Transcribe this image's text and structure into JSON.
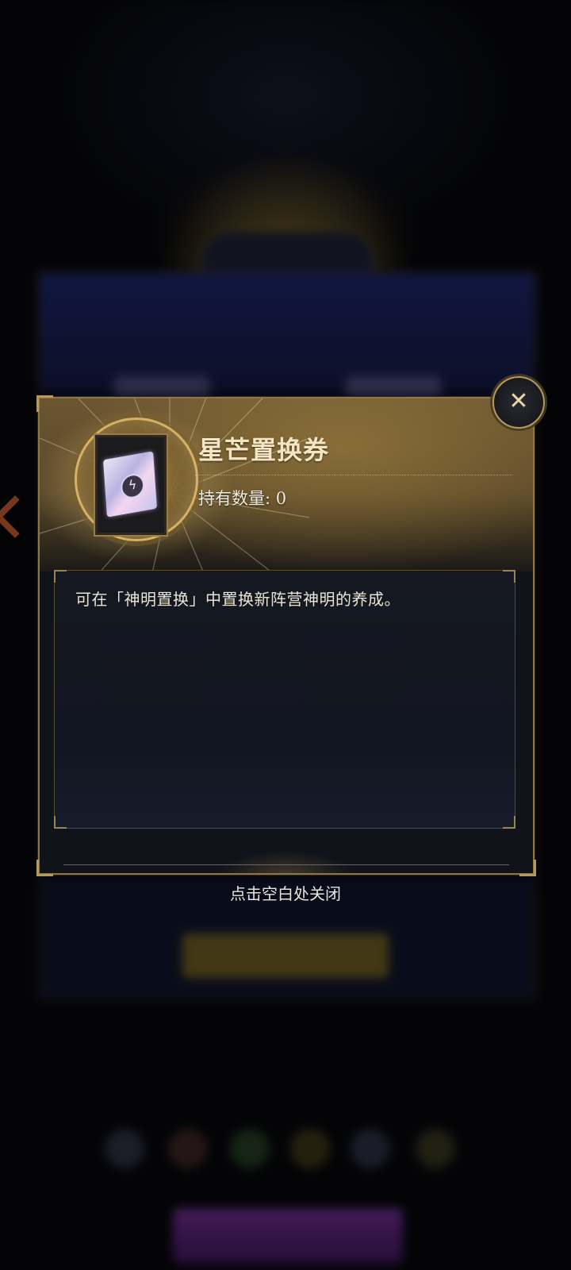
{
  "background": {
    "banner_text": "",
    "panel_text": "",
    "confirm_button": "",
    "caption": ""
  },
  "dialog": {
    "item_title": "星芒置换券",
    "quantity_label": "持有数量:",
    "quantity_value": "0",
    "description": "可在「神明置换」中置换新阵营神明的养成。",
    "item_icon": "ticket-icon",
    "close_icon": "close-icon"
  },
  "hint": {
    "close_hint": "点击空白处关闭"
  },
  "colors": {
    "accent_gold": "#b69a5d",
    "title_text": "#f4e6c2"
  }
}
